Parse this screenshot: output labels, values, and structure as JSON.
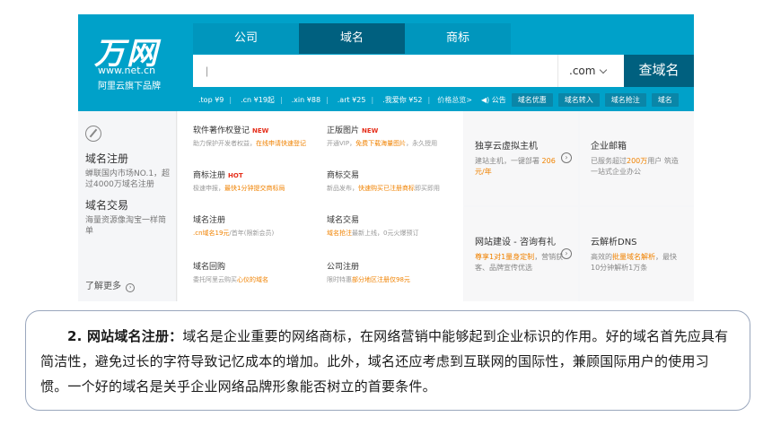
{
  "logo": {
    "brand": "万网",
    "url": "www.net.cn",
    "sub": "阿里云旗下品牌"
  },
  "tabs": [
    "公司",
    "域名",
    "商标"
  ],
  "search": {
    "placeholder": "",
    "suffix": ".com",
    "button": "查域名"
  },
  "prices": [
    {
      "ext": ".top",
      "price": "¥9"
    },
    {
      "ext": ".cn",
      "price": "¥19起"
    },
    {
      "ext": ".xin",
      "price": "¥88"
    },
    {
      "ext": ".art",
      "price": "¥25"
    },
    {
      "ext": ".我爱你",
      "price": "¥52"
    }
  ],
  "price_link": "价格总览>",
  "announce": "公告",
  "chips": [
    "域名优惠",
    "域名转入",
    "域名抢注",
    "域名"
  ],
  "left": {
    "title1": "域名注册",
    "desc1": "蝉联国内市场NO.1，超过4000万域名注册",
    "title2": "域名交易",
    "desc2": "海量资源像淘宝一样简单",
    "more": "了解更多",
    "more_arrow": "›"
  },
  "services": [
    {
      "title": "软件著作权登记",
      "tag": "NEW",
      "desc_pre": "助力保护开发者权益，",
      "desc_hl": "在线申请快速登记",
      "desc_post": ""
    },
    {
      "title": "正版图片",
      "tag": "NEW",
      "desc_pre": "开通VIP，",
      "desc_hl": "免费下载海量图片",
      "desc_post": "，永久授用"
    },
    {
      "title": "商标注册",
      "tag": "HOT",
      "desc_pre": "极速申报，",
      "desc_hl": "最快1分钟提交商标局",
      "desc_post": ""
    },
    {
      "title": "商标交易",
      "tag": "",
      "desc_pre": "新品发布，",
      "desc_hl": "快速购买已注册商标",
      "desc_post": "即买即用"
    },
    {
      "title": "域名注册",
      "tag": "",
      "desc_pre": "",
      "desc_hl": ".cn域名19元",
      "desc_post": "/首年(限新会员)"
    },
    {
      "title": "域名交易",
      "tag": "",
      "desc_pre": "",
      "desc_hl": "域名抢注",
      "desc_post": "最新上线，0元火爆预订"
    },
    {
      "title": "域名回购",
      "tag": "",
      "desc_pre": "委托阿里云购买",
      "desc_hl": "心仪的域名",
      "desc_post": ""
    },
    {
      "title": "公司注册",
      "tag": "",
      "desc_pre": "限时特惠",
      "desc_hl": "部分地区注册仅98元",
      "desc_post": ""
    }
  ],
  "cards": [
    {
      "title": "独享云虚拟主机",
      "desc_pre": "建站主机，一键部署 ",
      "desc_hl": "206元/年",
      "desc_post": "",
      "arrow": "›"
    },
    {
      "title": "企业邮箱",
      "desc_pre": "已服务超过",
      "desc_hl": "200万",
      "desc_post": "用户 筑造一站式企业办公",
      "arrow": ""
    },
    {
      "title": "网站建设 - 咨询有礼",
      "desc_pre": "",
      "desc_hl": "尊享1对1量身定制",
      "desc_post": "，营销获客、品牌宣传优选",
      "arrow": "›"
    },
    {
      "title": "云解析DNS",
      "desc_pre": "高效的",
      "desc_hl": "批量域名解析",
      "desc_post": "，最快 10分钟解析1万条",
      "arrow": ""
    }
  ],
  "paragraph": {
    "lead": "2. 网站域名注册：",
    "text": "域名是企业重要的网络商标，在网络营销中能够起到企业标识的作用。好的域名首先应具有简洁性，避免过长的字符导致记忆成本的增加。此外，域名还应考虑到互联网的国际性，兼顾国际用户的使用习惯。一个好的域名是关乎企业网络品牌形象能否树立的首要条件。"
  },
  "colors": {
    "header": "#00a1c9",
    "header_dark": "#00607f",
    "highlight": "#f08200",
    "tag_red": "#e52e1a"
  }
}
